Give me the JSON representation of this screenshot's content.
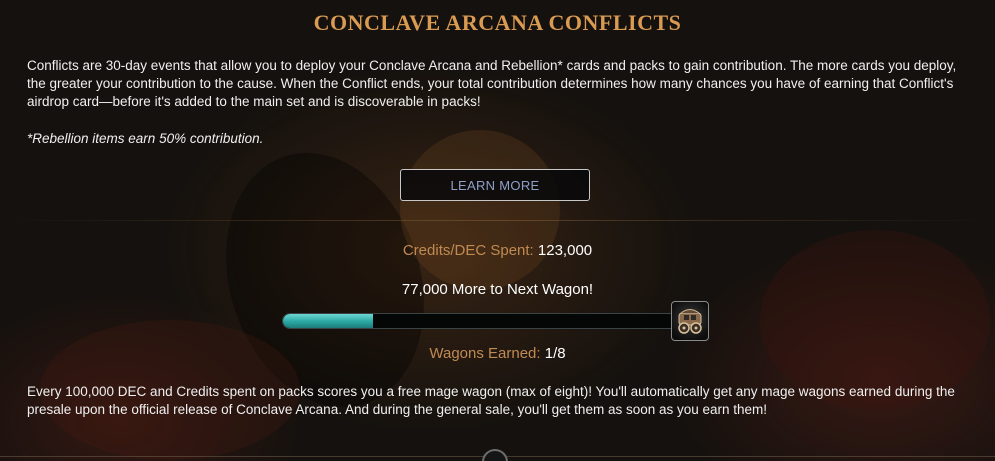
{
  "header": {
    "title": "CONCLAVE ARCANA CONFLICTS"
  },
  "intro": {
    "text": "Conflicts are 30-day events that allow you to deploy your Conclave Arcana and Rebellion* cards and packs to gain contribution. The more cards you deploy, the greater your contribution to the cause. When the Conflict ends, your total contribution determines how many chances you have of earning that Conflict's airdrop card—before it's added to the main set and is discoverable in packs!",
    "note": "*Rebellion items earn 50% contribution."
  },
  "actions": {
    "learn_more_label": "LEARN MORE"
  },
  "progress": {
    "credits_label": "Credits/DEC Spent:",
    "credits_value": "123,000",
    "next_wagon_text": "77,000 More to Next Wagon!",
    "fill_fraction": 0.23,
    "wagons_label": "Wagons Earned:",
    "wagons_value": "1/8",
    "icon": "wagon-icon"
  },
  "footer": {
    "text": "Every 100,000 DEC and Credits spent on packs scores you a free mage wagon (max of eight)! You'll automatically get any mage wagons earned during the presale upon the official release of Conclave Arcana. And during the general sale, you'll get them as soon as you earn them!"
  },
  "colors": {
    "title": "#d99a52",
    "label": "#c08a52",
    "bar_fill": "#2aa7a3",
    "button_text": "#8ea0c7"
  }
}
